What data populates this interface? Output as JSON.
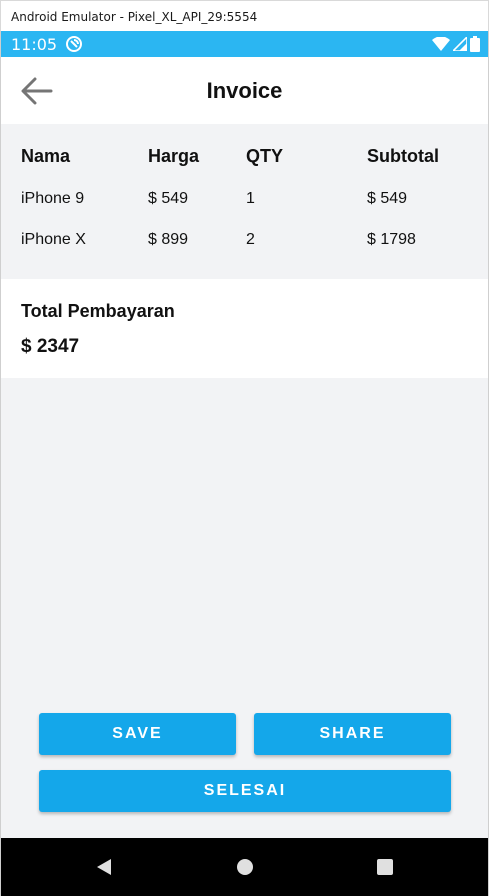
{
  "window": {
    "title": "Android Emulator - Pixel_XL_API_29:5554"
  },
  "status_bar": {
    "time": "11:05",
    "icons": [
      "app-notification-icon",
      "wifi-icon",
      "signal-icon",
      "battery-icon"
    ],
    "color": "#2bb6f2"
  },
  "app_bar": {
    "title": "Invoice",
    "back_icon": "arrow-left-icon"
  },
  "table": {
    "headers": [
      "Nama",
      "Harga",
      "QTY",
      "Subtotal"
    ],
    "rows": [
      [
        "iPhone 9",
        "$ 549",
        "1",
        "$ 549"
      ],
      [
        "iPhone X",
        "$ 899",
        "2",
        "$ 1798"
      ]
    ]
  },
  "total": {
    "label": "Total Pembayaran",
    "value": "$ 2347"
  },
  "buttons": {
    "save": "SAVE",
    "share": "SHARE",
    "selesai": "SELESAI",
    "color": "#14a7ea"
  },
  "nav_bar": {
    "icons": [
      "nav-back-icon",
      "nav-home-icon",
      "nav-recents-icon"
    ]
  }
}
